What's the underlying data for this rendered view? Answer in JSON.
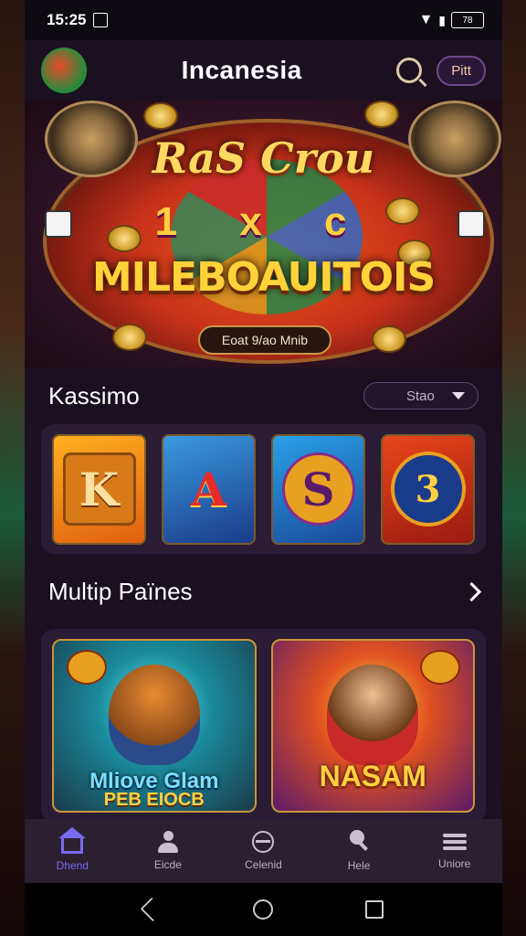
{
  "status": {
    "time": "15:25",
    "battery": "78"
  },
  "header": {
    "title": "Incanesia",
    "action_label": "Pitt"
  },
  "banner": {
    "title": "RaS Crou",
    "symbols": "1 x c",
    "subtitle": "MILEBOAUITOIS",
    "cta": "Eoat 9/ao Mnib"
  },
  "casino": {
    "title": "Kassimo",
    "filter": "Stao",
    "tiles": [
      {
        "symbol": "K"
      },
      {
        "symbol": "A"
      },
      {
        "symbol": "S"
      },
      {
        "symbol": "3"
      }
    ]
  },
  "multi": {
    "title": "Multip Païnes",
    "games": [
      {
        "title": "Mliove Glam",
        "subtitle": "PEB EIOCB"
      },
      {
        "title": "NASAM"
      }
    ]
  },
  "nav": {
    "items": [
      {
        "label": "Dhend"
      },
      {
        "label": "Eicde"
      },
      {
        "label": "Celenid"
      },
      {
        "label": "Hele"
      },
      {
        "label": "Uniore"
      }
    ]
  },
  "colors": {
    "accent": "#7a6af0",
    "background": "#1a1020",
    "gold": "#ffd040"
  }
}
